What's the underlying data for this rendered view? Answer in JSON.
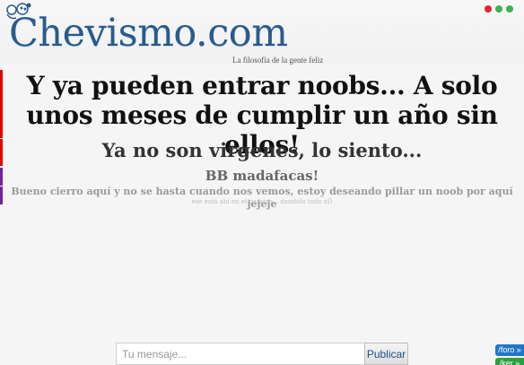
{
  "header": {
    "logo": "Chevismo.com",
    "tagline": "La filosofía de la gente feliz",
    "dot_colors": [
      "#e8232a",
      "#3cb44a",
      "#3cb44a"
    ]
  },
  "sidebar_colors": [
    "#e60000",
    "#e60000",
    "#7a1fa2",
    "#7a1fa2"
  ],
  "messages": {
    "line1": "Y ya pueden entrar noobs... A solo unos meses de cumplir un año sin ellos!",
    "line2": "Ya no son virgenes, lo siento...",
    "line3": "BB madafacas!",
    "line4": "Bueno cierro aquí y no se hasta cuando nos vemos, estoy deseando pillar un noob por aquí jejeje",
    "line5": "ese está ahí en el paraiso... dandolo todo xD"
  },
  "compose": {
    "placeholder": "Tu mensaje...",
    "value": "",
    "button": "Publicar"
  },
  "corner_links": {
    "foro": "/foro »",
    "other": "/ker »",
    "foro_color": "#1f77c9",
    "other_color": "#2e9e3e"
  }
}
